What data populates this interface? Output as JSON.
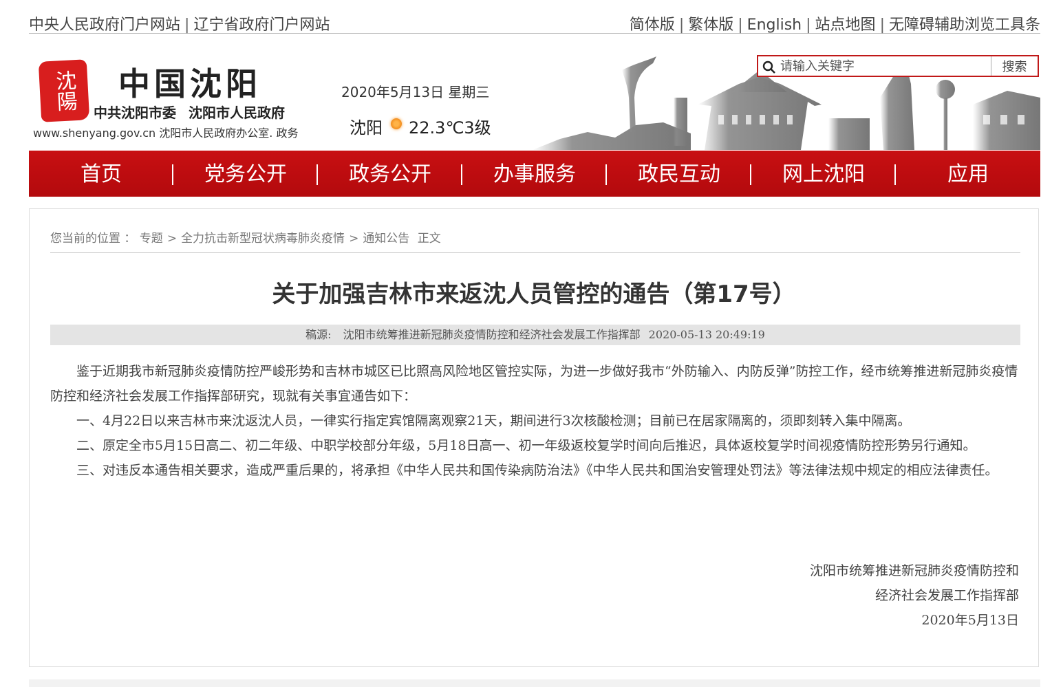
{
  "topbar": {
    "left_links": [
      "中央人民政府门户网站",
      "辽宁省政府门户网站"
    ],
    "right_links": [
      "简体版",
      "繁体版",
      "English",
      "站点地图",
      "无障碍辅助浏览工具条"
    ]
  },
  "header": {
    "seal_text": "沈陽",
    "logo_main": "中国沈阳",
    "logo_sub1": "中共沈阳市委",
    "logo_sub2": "沈阳市人民政府",
    "logo_url": "www.shenyang.gov.cn 沈阳市人民政府办公室. 政务",
    "date": "2020年5月13日 星期三",
    "city": "沈阳",
    "weather": "22.3℃3级"
  },
  "search": {
    "placeholder": "请输入关键字",
    "button": "搜索"
  },
  "nav": [
    "首页",
    "党务公开",
    "政务公开",
    "办事服务",
    "政民互动",
    "网上沈阳",
    "应用"
  ],
  "breadcrumb": {
    "prefix": "您当前的位置 ：",
    "items": [
      "专题",
      "全力抗击新型冠状病毒肺炎疫情",
      "通知公告"
    ],
    "current": "正文"
  },
  "article": {
    "title": "关于加强吉林市来返沈人员管控的通告（第17号）",
    "source_label": "稿源:",
    "source": "沈阳市统筹推进新冠肺炎疫情防控和经济社会发展工作指挥部",
    "datetime": "2020-05-13 20:49:19",
    "paragraphs": [
      "鉴于近期我市新冠肺炎疫情防控严峻形势和吉林市城区已比照高风险地区管控实际，为进一步做好我市“外防输入、内防反弹”防控工作，经市统筹推进新冠肺炎疫情防控和经济社会发展工作指挥部研究，现就有关事宜通告如下：",
      "一、4月22日以来吉林市来沈返沈人员，一律实行指定宾馆隔离观察21天，期间进行3次核酸检测；目前已在居家隔离的，须即刻转入集中隔离。",
      "二、原定全市5月15日高二、初二年级、中职学校部分年级，5月18日高一、初一年级返校复学时间向后推迟，具体返校复学时间视疫情防控形势另行通知。",
      "三、对违反本通告相关要求，造成严重后果的，将承担《中华人民共和国传染病防治法》《中华人民共和国治安管理处罚法》等法律法规中规定的相应法律责任。"
    ],
    "signature": [
      "沈阳市统筹推进新冠肺炎疫情防控和",
      "经济社会发展工作指挥部",
      "2020年5月13日"
    ]
  }
}
